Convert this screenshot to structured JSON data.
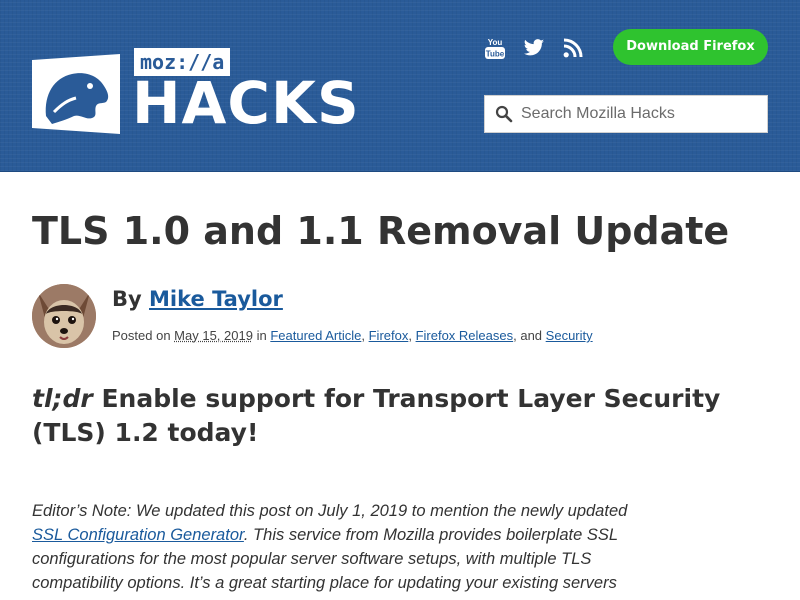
{
  "header": {
    "logo": {
      "wordmark": "moz://a",
      "site_name": "HACKS"
    },
    "social": [
      "youtube-icon",
      "twitter-icon",
      "rss-icon"
    ],
    "download_label": "Download Firefox",
    "search": {
      "placeholder": "Search Mozilla Hacks",
      "value": ""
    },
    "colors": {
      "background": "#2a5b98",
      "download_button": "#2fc32f"
    }
  },
  "article": {
    "title": "TLS 1.0 and 1.1 Removal Update",
    "author": {
      "by_prefix": "By",
      "name": "Mike Taylor"
    },
    "posted": {
      "prefix": "Posted on",
      "date": "May 15, 2019",
      "in_text": "in",
      "categories": [
        "Featured Article",
        "Firefox",
        "Firefox Releases",
        "Security"
      ],
      "and_text": ", and"
    },
    "tldr": {
      "label": "tl;dr",
      "text": "Enable support for Transport Layer Security (TLS) 1.2 today!"
    },
    "editor_note": {
      "part1": "Editor’s Note: We updated this post on July 1, 2019 to mention the newly updated",
      "link": "SSL Configuration Generator",
      "part2": ". This service from Mozilla provides boilerplate SSL configurations for the most popular server software setups, with multiple TLS compatibility options. It’s a great starting place for updating your existing servers"
    },
    "colors": {
      "link": "#1a5a9c",
      "text": "#333333"
    }
  }
}
